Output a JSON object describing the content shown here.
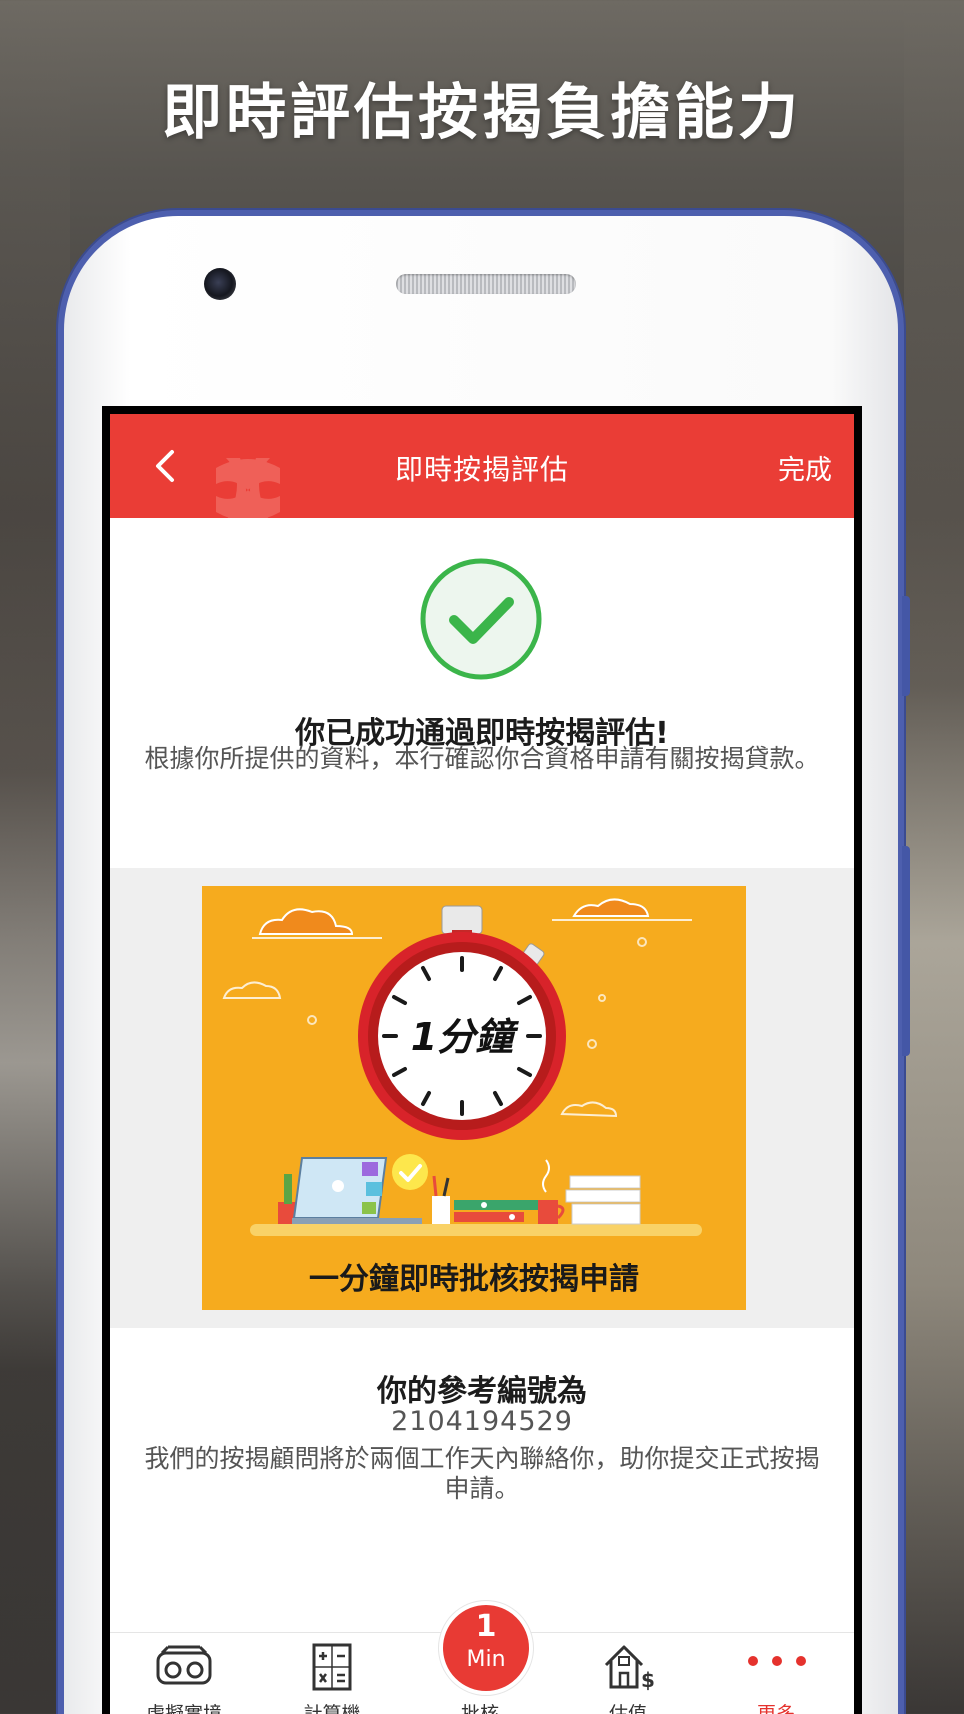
{
  "promo": {
    "title": "即時評估按揭負擔能力"
  },
  "header": {
    "back_icon": "chevron-left-icon",
    "title": "即時按揭評估",
    "done_label": "完成",
    "color": "#ea3d36"
  },
  "success": {
    "icon": "check-circle-icon",
    "heading": "你已成功通過即時按揭評估!",
    "body": "根據你所提供的資料，本行確認你合資格申請有關按揭貸款。",
    "icon_color": "#3bb54a"
  },
  "banner": {
    "clock_text": "1分鐘",
    "caption": "一分鐘即時批核按揭申請",
    "background": "#f6ab1e"
  },
  "reference": {
    "heading": "你的參考編號為",
    "number": "2104194529",
    "body": "我們的按揭顧問將於兩個工作天內聯絡你，助你提交正式按揭申請。"
  },
  "tab_bar": {
    "tabs": [
      {
        "icon": "vr-headset-icon",
        "label": "虛擬實境"
      },
      {
        "icon": "calculator-icon",
        "label": "計算機"
      },
      {
        "icon": "one-min-badge-icon",
        "label": "批核",
        "badge_number": "1",
        "badge_unit": "Min"
      },
      {
        "icon": "house-value-icon",
        "label": "估值"
      },
      {
        "icon": "more-dots-icon",
        "label": "更多",
        "active": true
      }
    ],
    "active_color": "#e5322d"
  }
}
